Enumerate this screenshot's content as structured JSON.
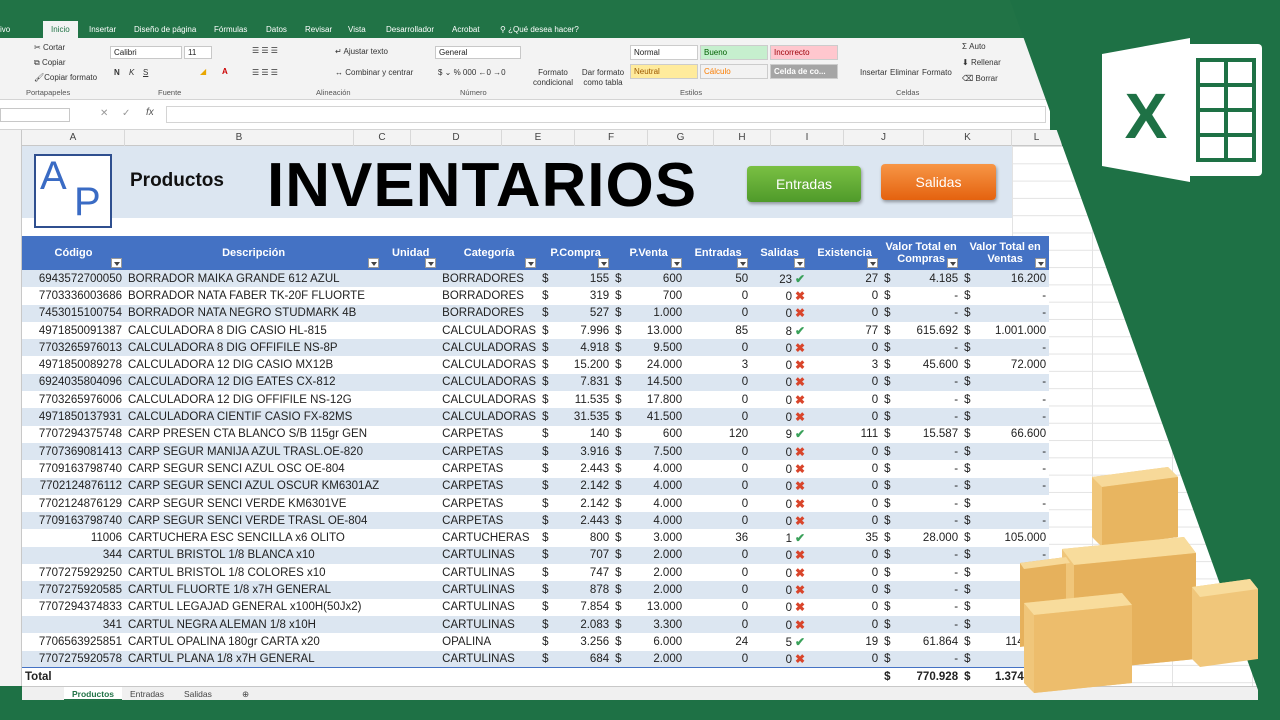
{
  "ribbon": {
    "tabs": [
      "ivo",
      "Inicio",
      "Insertar",
      "Diseño de página",
      "Fórmulas",
      "Datos",
      "Revisar",
      "Vista",
      "Desarrollador",
      "Acrobat",
      "¿Qué desea hacer?"
    ],
    "active_tab": "Inicio",
    "clipboard": {
      "cut": "Cortar",
      "copy": "Copiar",
      "format_painter": "Copiar formato",
      "group": "Portapapeles"
    },
    "font": {
      "name": "Calibri",
      "size": "11",
      "group": "Fuente"
    },
    "alignment": {
      "wrap": "Ajustar texto",
      "merge": "Combinar y centrar",
      "group": "Alineación"
    },
    "number": {
      "format": "General",
      "group": "Número"
    },
    "styles": {
      "cond_format": "Formato condicional",
      "as_table": "Dar formato como tabla",
      "cells": [
        "Normal",
        "Bueno",
        "Incorrecto",
        "Neutral",
        "Cálculo",
        "Celda de co..."
      ],
      "group": "Estilos"
    },
    "cells": {
      "insert": "Insertar",
      "delete": "Eliminar",
      "format": "Formato",
      "group": "Celdas"
    },
    "editing": {
      "autosum": "Auto",
      "fill": "Rellenar",
      "clear": "Borrar"
    }
  },
  "columns": [
    "A",
    "B",
    "C",
    "D",
    "E",
    "F",
    "G",
    "H",
    "I",
    "J",
    "K",
    "L"
  ],
  "banner": {
    "product_label": "Productos",
    "title": "INVENTARIOS",
    "logo_letters": [
      "A",
      "P"
    ],
    "btn_entradas": "Entradas",
    "btn_salidas": "Salidas"
  },
  "table": {
    "headers": [
      "Código",
      "Descripción",
      "Unidad",
      "Categoría",
      "P.Compra",
      "P.Venta",
      "Entradas",
      "Salidas",
      "Existencia",
      "Valor Total en Compras",
      "Valor Total en Ventas"
    ],
    "currency": "$",
    "rows": [
      [
        "6943572700050",
        "BORRADOR MAIKA GRANDE 612 AZUL",
        "",
        "BORRADORES",
        "155",
        "600",
        "50",
        "23",
        "ok",
        "27",
        "4.185",
        "16.200"
      ],
      [
        "7703336003686",
        "BORRADOR NATA FABER TK-20F FLUORTE",
        "",
        "BORRADORES",
        "319",
        "700",
        "0",
        "0",
        "no",
        "0",
        "-",
        "-"
      ],
      [
        "7453015100754",
        "BORRADOR NATA NEGRO STUDMARK 4B",
        "",
        "BORRADORES",
        "527",
        "1.000",
        "0",
        "0",
        "no",
        "0",
        "-",
        "-"
      ],
      [
        "4971850091387",
        "CALCULADORA  8 DIG CASIO HL-815",
        "",
        "CALCULADORAS",
        "7.996",
        "13.000",
        "85",
        "8",
        "ok",
        "77",
        "615.692",
        "1.001.000"
      ],
      [
        "7703265976013",
        "CALCULADORA  8 DIG OFFIFILE NS-8P",
        "",
        "CALCULADORAS",
        "4.918",
        "9.500",
        "0",
        "0",
        "no",
        "0",
        "-",
        "-"
      ],
      [
        "4971850089278",
        "CALCULADORA 12 DIG CASIO MX12B",
        "",
        "CALCULADORAS",
        "15.200",
        "24.000",
        "3",
        "0",
        "no",
        "3",
        "45.600",
        "72.000"
      ],
      [
        "6924035804096",
        "CALCULADORA 12 DIG EATES CX-812",
        "",
        "CALCULADORAS",
        "7.831",
        "14.500",
        "0",
        "0",
        "no",
        "0",
        "-",
        "-"
      ],
      [
        "7703265976006",
        "CALCULADORA 12 DIG OFFIFILE NS-12G",
        "",
        "CALCULADORAS",
        "11.535",
        "17.800",
        "0",
        "0",
        "no",
        "0",
        "-",
        "-"
      ],
      [
        "4971850137931",
        "CALCULADORA CIENTIF CASIO FX-82MS",
        "",
        "CALCULADORAS",
        "31.535",
        "41.500",
        "0",
        "0",
        "no",
        "0",
        "-",
        "-"
      ],
      [
        "7707294375748",
        "CARP PRESEN CTA BLANCO S/B 115gr GEN",
        "",
        "CARPETAS",
        "140",
        "600",
        "120",
        "9",
        "ok",
        "111",
        "15.587",
        "66.600"
      ],
      [
        "7707369081413",
        "CARP SEGUR MANIJA AZUL TRASL.OE-820",
        "",
        "CARPETAS",
        "3.916",
        "7.500",
        "0",
        "0",
        "no",
        "0",
        "-",
        "-"
      ],
      [
        "7709163798740",
        "CARP SEGUR SENCI AZUL OSC OE-804",
        "",
        "CARPETAS",
        "2.443",
        "4.000",
        "0",
        "0",
        "no",
        "0",
        "-",
        "-"
      ],
      [
        "7702124876112",
        "CARP SEGUR SENCI AZUL OSCUR KM6301AZ",
        "",
        "CARPETAS",
        "2.142",
        "4.000",
        "0",
        "0",
        "no",
        "0",
        "-",
        "-"
      ],
      [
        "7702124876129",
        "CARP SEGUR SENCI VERDE KM6301VE",
        "",
        "CARPETAS",
        "2.142",
        "4.000",
        "0",
        "0",
        "no",
        "0",
        "-",
        "-"
      ],
      [
        "7709163798740",
        "CARP SEGUR SENCI VERDE TRASL OE-804",
        "",
        "CARPETAS",
        "2.443",
        "4.000",
        "0",
        "0",
        "no",
        "0",
        "-",
        "-"
      ],
      [
        "11006",
        "CARTUCHERA ESC SENCILLA x6 OLITO",
        "",
        "CARTUCHERAS",
        "800",
        "3.000",
        "36",
        "1",
        "ok",
        "35",
        "28.000",
        "105.000"
      ],
      [
        "344",
        "CARTUL BRISTOL 1/8 BLANCA  x10",
        "",
        "CARTULINAS",
        "707",
        "2.000",
        "0",
        "0",
        "no",
        "0",
        "-",
        "-"
      ],
      [
        "7707275929250",
        "CARTUL BRISTOL 1/8 COLORES x10",
        "",
        "CARTULINAS",
        "747",
        "2.000",
        "0",
        "0",
        "no",
        "0",
        "-",
        "-"
      ],
      [
        "7707275920585",
        "CARTUL FLUORTE 1/8 x7H GENERAL",
        "",
        "CARTULINAS",
        "878",
        "2.000",
        "0",
        "0",
        "no",
        "0",
        "-",
        "-"
      ],
      [
        "7707294374833",
        "CARTUL LEGAJAD GENERAL x100H(50Jx2)",
        "",
        "CARTULINAS",
        "7.854",
        "13.000",
        "0",
        "0",
        "no",
        "0",
        "-",
        "-"
      ],
      [
        "341",
        "CARTUL NEGRA ALEMAN 1/8 x10H",
        "",
        "CARTULINAS",
        "2.083",
        "3.300",
        "0",
        "0",
        "no",
        "0",
        "-",
        "-"
      ],
      [
        "7706563925851",
        "CARTUL OPALINA 180gr CARTA x20",
        "",
        "OPALINA",
        "3.256",
        "6.000",
        "24",
        "5",
        "ok",
        "19",
        "61.864",
        "114.000"
      ],
      [
        "7707275920578",
        "CARTUL PLANA 1/8 x7H GENERAL",
        "",
        "CARTULINAS",
        "684",
        "2.000",
        "0",
        "0",
        "no",
        "0",
        "-",
        "-"
      ]
    ],
    "total_label": "Total",
    "total_compras": "770.928",
    "total_ventas": "1.374.800"
  },
  "sheet_tabs": [
    "Productos",
    "Entradas",
    "Salidas"
  ],
  "active_sheet": "Productos",
  "colors": {
    "excel_green": "#217346",
    "header_blue": "#4472c4",
    "band_blue": "#dce6f1",
    "ok_green": "#3aa15a",
    "no_red": "#d9452b"
  }
}
